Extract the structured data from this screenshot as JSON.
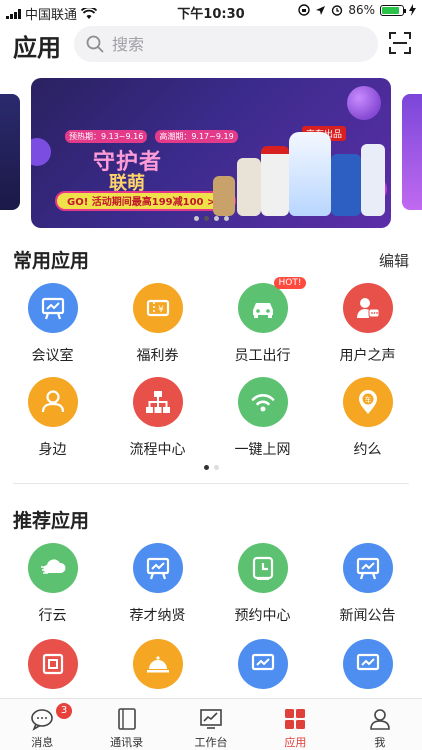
{
  "status_bar": {
    "carrier": "中国联通",
    "time": "下午10:30",
    "battery": "86%"
  },
  "header": {
    "title": "应用",
    "search_placeholder": "搜索"
  },
  "banner": {
    "dates": [
      "预热期：9.13~9.16",
      "高潮期：9.17~9.19"
    ],
    "title_line1": "守护者",
    "title_line2": "联萌",
    "promo": "GO! 活动期间最高199减100 >>",
    "badge": "京东出品",
    "active_index": 1,
    "count": 4
  },
  "common_apps": {
    "title": "常用应用",
    "action": "编辑",
    "items": [
      {
        "label": "会议室",
        "icon": "presentation-board-icon",
        "color": "#4d8ef0"
      },
      {
        "label": "福利券",
        "icon": "coupon-icon",
        "color": "#f5a623"
      },
      {
        "label": "员工出行",
        "icon": "car-icon",
        "color": "#5cc170",
        "badge": "HOT!"
      },
      {
        "label": "用户之声",
        "icon": "user-chat-icon",
        "color": "#e8504a"
      },
      {
        "label": "身边",
        "icon": "person-icon",
        "color": "#f5a623"
      },
      {
        "label": "流程中心",
        "icon": "org-chart-icon",
        "color": "#e8504a"
      },
      {
        "label": "一键上网",
        "icon": "wifi-icon",
        "color": "#5cc170"
      },
      {
        "label": "约么",
        "icon": "car-pin-icon",
        "color": "#f5a623"
      }
    ],
    "page_index": 0,
    "page_count": 2
  },
  "recommended_apps": {
    "title": "推荐应用",
    "items": [
      {
        "label": "行云",
        "icon": "cloud-speed-icon",
        "color": "#5cc170"
      },
      {
        "label": "荐才纳贤",
        "icon": "presentation-board-icon",
        "color": "#4d8ef0"
      },
      {
        "label": "预约中心",
        "icon": "clock-calendar-icon",
        "color": "#5cc170"
      },
      {
        "label": "新闻公告",
        "icon": "presentation-board-icon",
        "color": "#4d8ef0"
      },
      {
        "label": "",
        "icon": "grid-box-icon",
        "color": "#e8504a"
      },
      {
        "label": "",
        "icon": "food-cloche-icon",
        "color": "#f5a623"
      },
      {
        "label": "",
        "icon": "presentation-board-icon",
        "color": "#4d8ef0"
      },
      {
        "label": "",
        "icon": "presentation-board-icon",
        "color": "#4d8ef0"
      }
    ]
  },
  "tabbar": {
    "items": [
      {
        "label": "消息",
        "icon": "message-icon",
        "badge": "3"
      },
      {
        "label": "通讯录",
        "icon": "contacts-book-icon"
      },
      {
        "label": "工作台",
        "icon": "workbench-chart-icon"
      },
      {
        "label": "应用",
        "icon": "apps-grid-icon",
        "active": true
      },
      {
        "label": "我",
        "icon": "profile-icon"
      }
    ],
    "active_color": "#e0403a"
  }
}
